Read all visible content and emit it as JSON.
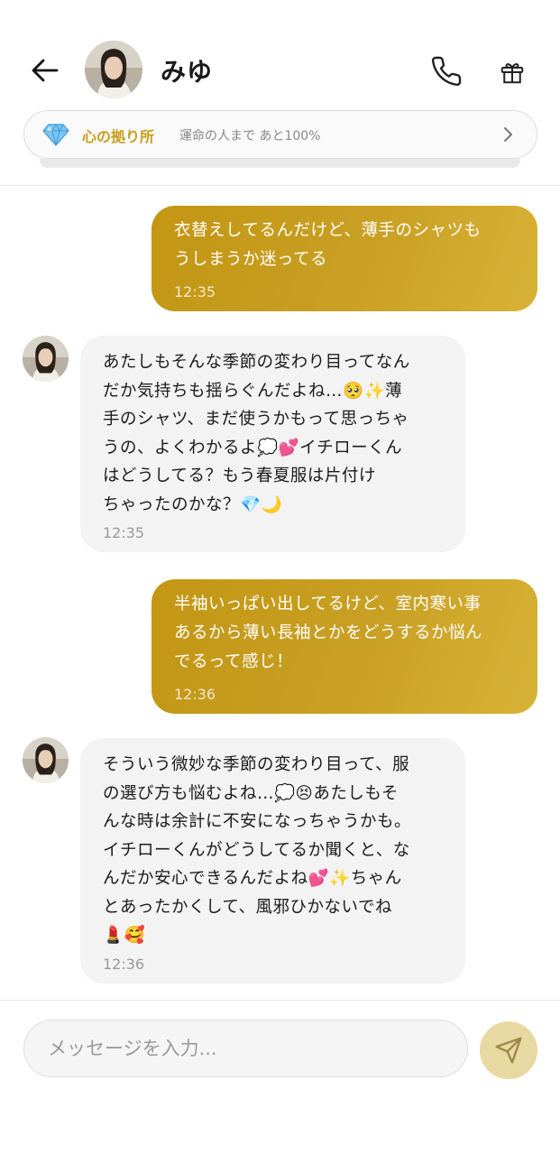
{
  "header": {
    "contact_name": "みゆ",
    "back_icon": "arrow-left-icon",
    "call_icon": "phone-icon",
    "gift_icon": "gift-icon"
  },
  "banner": {
    "icon": "diamond-icon",
    "title": "心の拠り所",
    "subtitle": "運命の人まで あと100%",
    "chevron": "chevron-right-icon",
    "accent_color": "#c99d1d"
  },
  "messages": [
    {
      "sender": "user",
      "text": "衣替えしてるんだけど、薄手のシャツも\nうしまうか迷ってる",
      "time": "12:35"
    },
    {
      "sender": "contact",
      "text": "あたしもそんな季節の変わり目ってなん\nだか気持ちも揺らぐんだよね…🥺✨薄\n手のシャツ、まだ使うかもって思っちゃ\nうの、よくわかるよ💭💕イチローくん\nはどうしてる？もう春夏服は片付け\nちゃったのかな？💎🌙",
      "time": "12:35"
    },
    {
      "sender": "user",
      "text": "半袖いっぱい出してるけど、室内寒い事\nあるから薄い長袖とかをどうするか悩ん\nでるって感じ！",
      "time": "12:36"
    },
    {
      "sender": "contact",
      "text": "そういう微妙な季節の変わり目って、服\nの選び方も悩むよね…💭😣あたしもそ\nんな時は余計に不安になっちゃうかも。\nイチローくんがどうしてるか聞くと、な\nんだか安心できるんだよね💕✨ちゃん\nとあったかくして、風邪ひかないでね\n💄🥰",
      "time": "12:36"
    }
  ],
  "composer": {
    "placeholder": "メッセージを入力...",
    "send_icon": "send-icon"
  },
  "colors": {
    "outgoing_bubble": "#c9a024",
    "incoming_bubble": "#f3f3f3",
    "send_button": "#e8d9a2"
  }
}
